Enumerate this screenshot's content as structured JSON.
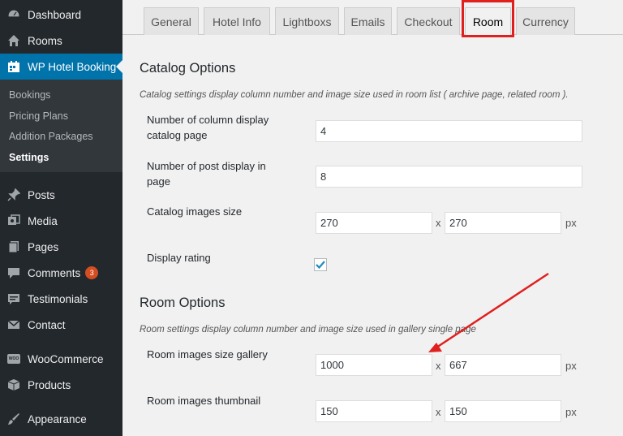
{
  "sidebar": {
    "items": [
      {
        "label": "Dashboard",
        "icon": "dashboard-icon"
      },
      {
        "label": "Rooms",
        "icon": "home-icon"
      },
      {
        "label": "WP Hotel Booking",
        "icon": "calendar-icon"
      },
      {
        "label": "Posts",
        "icon": "pin-icon"
      },
      {
        "label": "Media",
        "icon": "media-icon"
      },
      {
        "label": "Pages",
        "icon": "pages-icon"
      },
      {
        "label": "Comments",
        "icon": "comment-icon",
        "badge": "3"
      },
      {
        "label": "Testimonials",
        "icon": "testimonial-icon"
      },
      {
        "label": "Contact",
        "icon": "mail-icon"
      },
      {
        "label": "WooCommerce",
        "icon": "woo-icon",
        "icon_text": "WOO"
      },
      {
        "label": "Products",
        "icon": "box-icon"
      },
      {
        "label": "Appearance",
        "icon": "brush-icon"
      }
    ],
    "submenu": [
      "Bookings",
      "Pricing Plans",
      "Addition Packages",
      "Settings"
    ],
    "active_color": "#0073aa"
  },
  "tabs": [
    "General",
    "Hotel Info",
    "Lightboxs",
    "Emails",
    "Checkout",
    "Room",
    "Currency"
  ],
  "catalog": {
    "title": "Catalog Options",
    "description": "Catalog settings display column number and image size used in room list ( archive page, related room ).",
    "columns_label": "Number of column display catalog page",
    "columns_value": "4",
    "posts_label": "Number of post display in page",
    "posts_value": "8",
    "image_size_label": "Catalog images size",
    "image_width": "270",
    "image_height": "270",
    "rating_label": "Display rating",
    "rating_checked": true
  },
  "room": {
    "title": "Room Options",
    "description": "Room settings display column number and image size used in gallery single page",
    "gallery_label": "Room images size gallery",
    "gallery_width": "1000",
    "gallery_height": "667",
    "thumb_label": "Room images thumbnail",
    "thumb_width": "150",
    "thumb_height": "150"
  },
  "units": {
    "sep": "x",
    "px": "px"
  },
  "highlight_color": "#e0201f"
}
